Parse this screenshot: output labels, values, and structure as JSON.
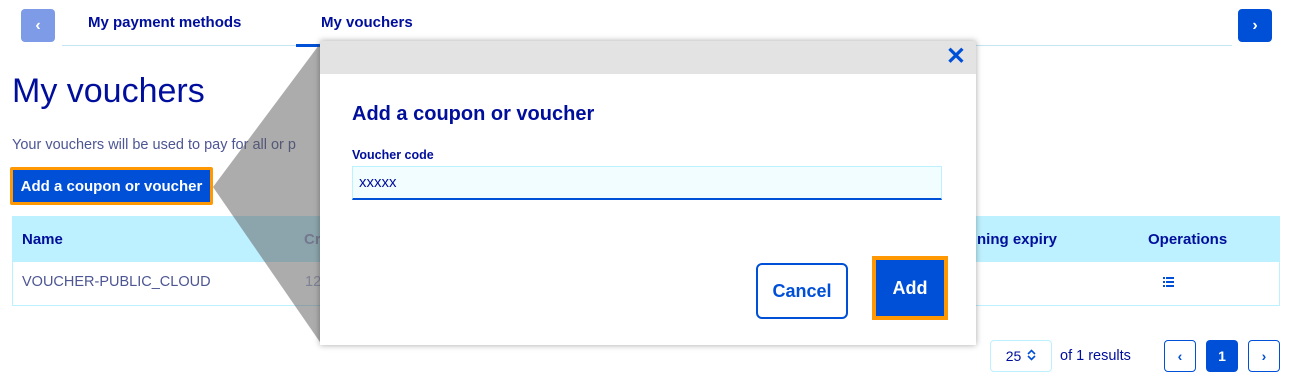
{
  "tabs": {
    "prev_icon": "‹",
    "next_icon": "›",
    "items": [
      {
        "label": "My payment methods"
      },
      {
        "label": "My vouchers"
      }
    ]
  },
  "page": {
    "title": "My vouchers",
    "intro": "Your vouchers will be used to pay for all or p",
    "add_button": "Add a coupon or voucher"
  },
  "table": {
    "headers": [
      "Name",
      "Cr",
      "ning expiry",
      "Operations"
    ],
    "rows": [
      {
        "name": "VOUCHER-PUBLIC_CLOUD",
        "created": "12",
        "ops_icon": "list-icon"
      }
    ]
  },
  "pagination": {
    "per_page": "25",
    "results_text": "of 1 results",
    "current_page": "1",
    "prev_icon": "‹",
    "next_icon": "›"
  },
  "modal": {
    "close_icon": "✕",
    "title": "Add a coupon or voucher",
    "field_label": "Voucher code",
    "field_value": "xxxxx",
    "cancel_label": "Cancel",
    "add_label": "Add"
  },
  "colors": {
    "primary": "#0050d7",
    "text_dark": "#000e9c",
    "header_bg": "#bef1ff",
    "highlight": "#ff9803"
  }
}
